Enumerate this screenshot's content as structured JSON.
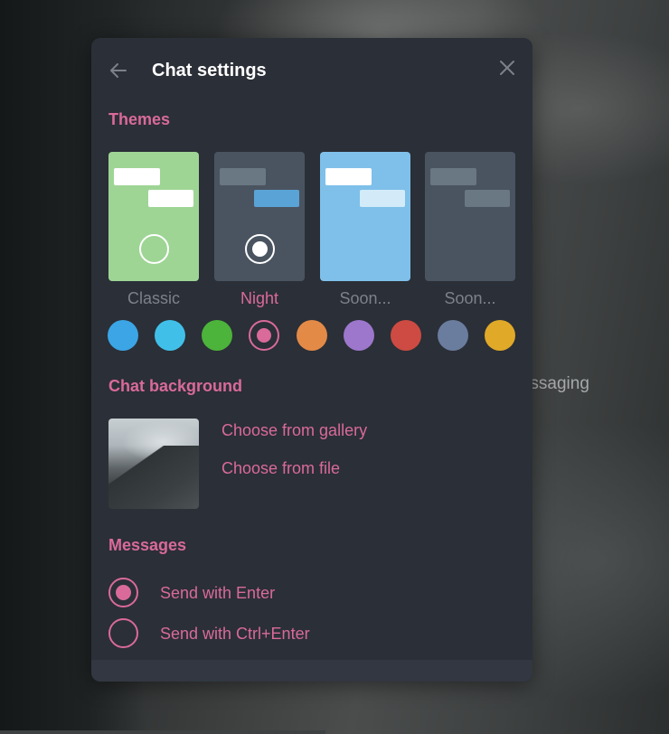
{
  "window": {
    "title": "Chat settings"
  },
  "background_text": "messaging",
  "themes": {
    "section_title": "Themes",
    "cards": [
      {
        "label": "Classic",
        "bg": "#9ed595",
        "bubble_in": "#ffffff",
        "bubble_out": "#ffffff",
        "radio": "unselected"
      },
      {
        "label": "Night",
        "bg": "#4a5460",
        "bubble_in": "#6a7884",
        "bubble_out": "#5aa3d6",
        "radio": "selected"
      },
      {
        "label": "Soon...",
        "bg": "#7ec0ea",
        "bubble_in": "#ffffff",
        "bubble_out": "#d3ebf8",
        "radio": "none"
      },
      {
        "label": "Soon...",
        "bg": "#4a5460",
        "bubble_in": "#6a7884",
        "bubble_out": "#6a7884",
        "radio": "none"
      }
    ],
    "accent_colors": [
      "#3ba5e6",
      "#40c0e9",
      "#4cb33b",
      "#d96a9a",
      "#e48a47",
      "#9c77cc",
      "#cd4b42",
      "#6a7d9e",
      "#e0a928"
    ],
    "selected_accent_index": 3
  },
  "chat_background": {
    "section_title": "Chat background",
    "choose_gallery": "Choose from gallery",
    "choose_file": "Choose from file"
  },
  "messages": {
    "section_title": "Messages",
    "options": [
      {
        "label": "Send with Enter",
        "selected": true
      },
      {
        "label": "Send with Ctrl+Enter",
        "selected": false
      }
    ]
  },
  "colors": {
    "accent": "#d96a9a",
    "dialog_bg": "#2b2f37",
    "muted_text": "#7c818b"
  }
}
